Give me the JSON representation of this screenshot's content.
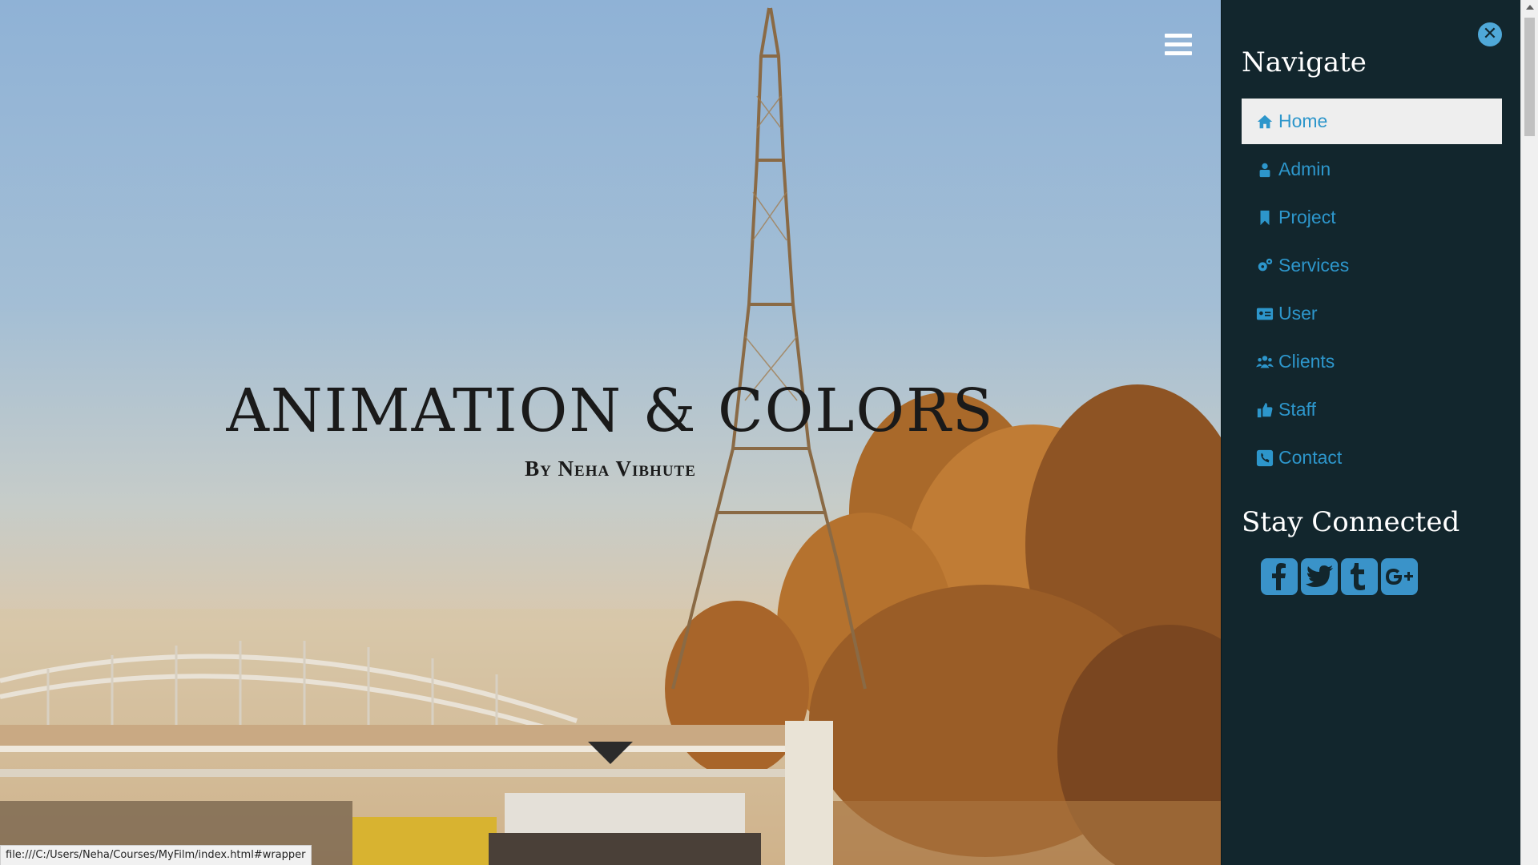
{
  "hero": {
    "title": "ANIMATION & COLORS",
    "subtitle": "By Neha Vibhute"
  },
  "status_bar": {
    "url": "file:///C:/Users/Neha/Courses/MyFilm/index.html#wrapper"
  },
  "sidebar": {
    "nav_heading": "Navigate",
    "items": [
      {
        "label": "Home",
        "icon": "home-icon",
        "active": true
      },
      {
        "label": "Admin",
        "icon": "admin-icon"
      },
      {
        "label": "Project",
        "icon": "bookmark-icon"
      },
      {
        "label": "Services",
        "icon": "gears-icon"
      },
      {
        "label": "User",
        "icon": "id-card-icon"
      },
      {
        "label": "Clients",
        "icon": "users-icon"
      },
      {
        "label": "Staff",
        "icon": "thumbs-up-icon"
      },
      {
        "label": "Contact",
        "icon": "phone-icon"
      }
    ],
    "social_heading": "Stay Connected",
    "social": [
      {
        "name": "facebook",
        "glyph": "f"
      },
      {
        "name": "twitter",
        "glyph": "t-bird"
      },
      {
        "name": "tumblr",
        "glyph": "t"
      },
      {
        "name": "google-plus",
        "glyph": "G+"
      }
    ]
  },
  "colors": {
    "sidebar_bg": "#12262d",
    "accent": "#2d96cb",
    "active_bg": "#eeeeee"
  }
}
